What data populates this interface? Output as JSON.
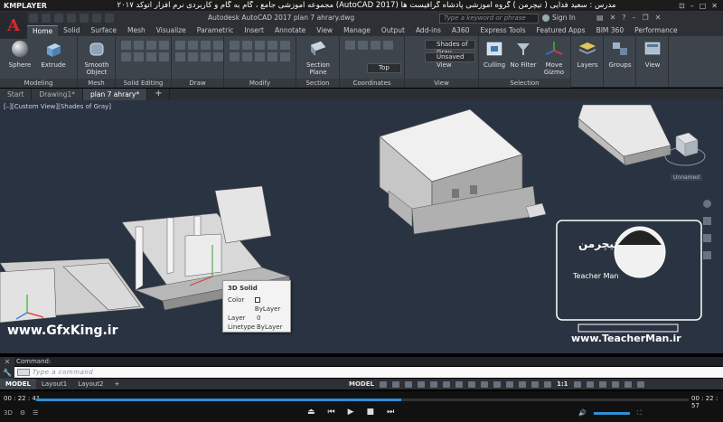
{
  "player": {
    "logo": "KMPLAYER",
    "title": "مجموعه آموزشی جامع ، گام به گام و کاربردی نرم افزار اتوکد ٢٠١٧ (AutoCAD 2017) مدرس : سعید فدایی ( تیچرمن ) گروه آموزشی پادشاه گرافیست ها",
    "time_elapsed": "00 : 22 : 41",
    "time_total": "00 : 22 : 57",
    "progress_percent": 56
  },
  "autocad": {
    "app_letter": "A",
    "caption": "Autodesk AutoCAD 2017    plan 7 ahrary.dwg",
    "search_placeholder": "Type a keyword or phrase",
    "sign_in": "Sign In",
    "tabs": [
      "Home",
      "Solid",
      "Surface",
      "Mesh",
      "Visualize",
      "Parametric",
      "Insert",
      "Annotate",
      "View",
      "Manage",
      "Output",
      "Add-ins",
      "A360",
      "Express Tools",
      "Featured Apps",
      "BIM 360",
      "Performance"
    ],
    "ribbon": {
      "tools": {
        "sphere": "Sphere",
        "extrude": "Extrude",
        "smooth_object_1": "Smooth",
        "smooth_object_2": "Object",
        "section_plane_1": "Section",
        "section_plane_2": "Plane",
        "culling": "Culling",
        "no_filter": "No Filter",
        "move_gizmo_1": "Move",
        "move_gizmo_2": "Gizmo",
        "layers": "Layers",
        "groups": "Groups",
        "view": "View"
      },
      "dropdowns": {
        "visual_style": "Shades of Gray",
        "unsaved_view": "Unsaved View",
        "top": "Top"
      },
      "panels": [
        "Modeling",
        "Mesh",
        "Solid Editing",
        "Draw",
        "Modify",
        "Section",
        "Coordinates",
        "View",
        "Selection"
      ]
    },
    "file_tabs": [
      "Start",
      "Drawing1*",
      "plan 7 ahrary*"
    ],
    "viewport_label": "[–][Custom View][Shades of Gray]",
    "viewcube_label": "Unnamed",
    "tooltip": {
      "title": "3D Solid",
      "rows": [
        {
          "key": "Color",
          "value": "ByLayer"
        },
        {
          "key": "Layer",
          "value": "0"
        },
        {
          "key": "Linetype",
          "value": "ByLayer"
        }
      ]
    },
    "command_history": "Command:",
    "command_placeholder": "Type a command",
    "layout_tabs": [
      "MODEL",
      "Layout1",
      "Layout2"
    ],
    "status_model": "MODEL",
    "status_scale": "1:1"
  },
  "watermarks": {
    "gfxking": "www.GfxKing.ir",
    "teacherman_url": "www.TeacherMan.ir",
    "teacherman_name": "Teacher Man",
    "teacherman_fa": "تیچرمن"
  },
  "colors": {
    "viewport_bg": "#2a3341",
    "ribbon_bg": "#3e444c",
    "accent_blue": "#2e8ed6",
    "autocad_red": "#d42a2a"
  }
}
